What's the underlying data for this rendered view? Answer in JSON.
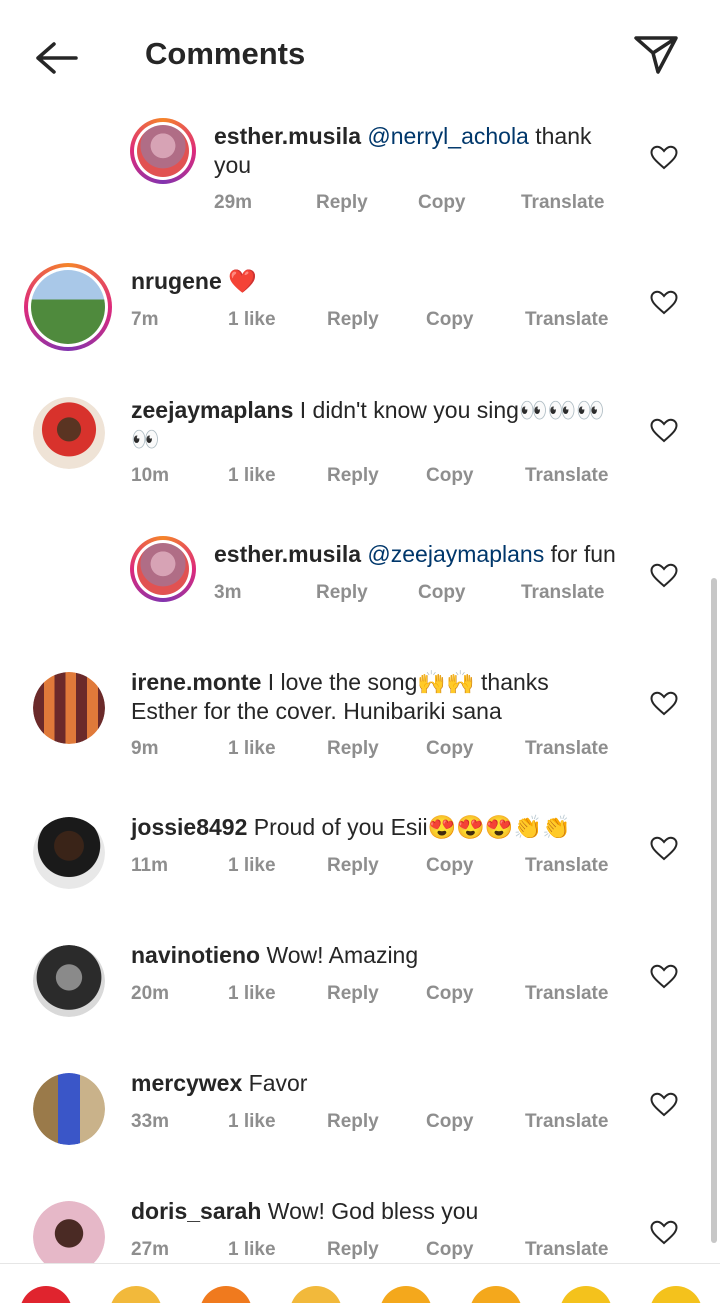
{
  "header": {
    "title": "Comments"
  },
  "comments": [
    {
      "user": "esther.musila",
      "mention": "@nerryl_achola",
      "text": "thank",
      "text2": "you",
      "time": "29m",
      "likes": "",
      "reply": "Reply",
      "copy": "Copy",
      "translate": "Translate"
    },
    {
      "user": "nrugene",
      "mention": "",
      "text": "❤️",
      "time": "7m",
      "likes": "1 like",
      "reply": "Reply",
      "copy": "Copy",
      "translate": "Translate"
    },
    {
      "user": "zeejaymaplans",
      "mention": "",
      "text": "I didn't know you sing👀👀👀",
      "text2": "👀",
      "time": "10m",
      "likes": "1 like",
      "reply": "Reply",
      "copy": "Copy",
      "translate": "Translate"
    },
    {
      "user": "esther.musila",
      "mention": "@zeejaymaplans",
      "text": "for fun",
      "time": "3m",
      "likes": "",
      "reply": "Reply",
      "copy": "Copy",
      "translate": "Translate"
    },
    {
      "user": "irene.monte",
      "mention": "",
      "text": "I love the song🙌🙌 thanks",
      "text2": "Esther for the cover. Hunibariki sana",
      "time": "9m",
      "likes": "1 like",
      "reply": "Reply",
      "copy": "Copy",
      "translate": "Translate"
    },
    {
      "user": "jossie8492",
      "mention": "",
      "text": "Proud of you Esii😍😍😍👏👏",
      "time": "11m",
      "likes": "1 like",
      "reply": "Reply",
      "copy": "Copy",
      "translate": "Translate"
    },
    {
      "user": "navinotieno",
      "mention": "",
      "text": "Wow! Amazing",
      "time": "20m",
      "likes": "1 like",
      "reply": "Reply",
      "copy": "Copy",
      "translate": "Translate"
    },
    {
      "user": "mercywex",
      "mention": "",
      "text": "Favor",
      "time": "33m",
      "likes": "1 like",
      "reply": "Reply",
      "copy": "Copy",
      "translate": "Translate"
    },
    {
      "user": "doris_sarah",
      "mention": "",
      "text": "Wow! God bless you",
      "time": "27m",
      "likes": "1 like",
      "reply": "Reply",
      "copy": "Copy",
      "translate": "Translate"
    }
  ],
  "colors": {
    "text": "#262626",
    "meta": "#8e8e8e",
    "mention": "#00376b",
    "ring_start": "#f58529",
    "ring_end": "#dd2a7b"
  },
  "icons": {
    "back": "arrow-left-icon",
    "share": "paper-plane-icon",
    "like": "heart-outline-icon"
  },
  "emoji_bar": [
    "❤️",
    "🙌",
    "🔥",
    "👏",
    "😢",
    "😍",
    "😮",
    "😂"
  ]
}
